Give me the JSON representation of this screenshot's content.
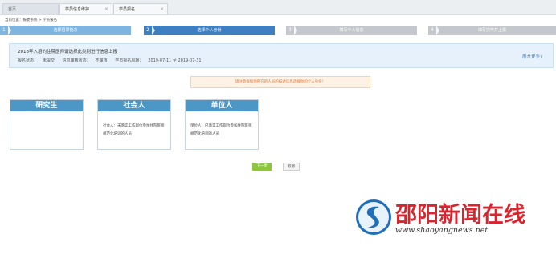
{
  "tabs": [
    {
      "label": "首页"
    },
    {
      "label": "学员信息维护"
    },
    {
      "label": "学员报名"
    }
  ],
  "breadcrumb": "当前位置：报委系统 > 学员报名",
  "steps": [
    {
      "num": "1",
      "label": "选择招录批次"
    },
    {
      "num": "2",
      "label": "选择个人身份"
    },
    {
      "num": "3",
      "label": "填写个人信息"
    },
    {
      "num": "4",
      "label": "填写完毕并上报"
    }
  ],
  "info": {
    "title": "2018年入培的住院医师请选择此类别进行信息上报",
    "status_label": "报名状态：",
    "status_value": "未提交",
    "audit_label": "信息审核状态：",
    "audit_value": "不审核",
    "period_label": "学员报名周期：",
    "period_value": "2019-07-11 至 2019-07-31",
    "more": "展开更多∨"
  },
  "notice": "请注意根据你所在的人员的描述信息选择你的个人身份！",
  "cards": [
    {
      "title": "研究生",
      "desc": ""
    },
    {
      "title": "社会人",
      "desc": "社会人：未落实工作岗位参加住院医师规范化培训的人员"
    },
    {
      "title": "单位人",
      "desc": "单位人：已落实工作岗位参加住院医师规范化培训的人员"
    }
  ],
  "buttons": {
    "next": "下一步",
    "cancel": "取消"
  },
  "watermark": {
    "name": "邵阳新闻在线",
    "url": "www.shaoyangnews.net"
  },
  "colors": {
    "active_step": "#3e7fc1",
    "done_step": "#7db4e0",
    "todo_step": "#c4c8cc",
    "card_header": "#4d97c7",
    "next_button": "#8cc63e",
    "notice_text": "#e3793a",
    "watermark_red": "#d9232d"
  }
}
